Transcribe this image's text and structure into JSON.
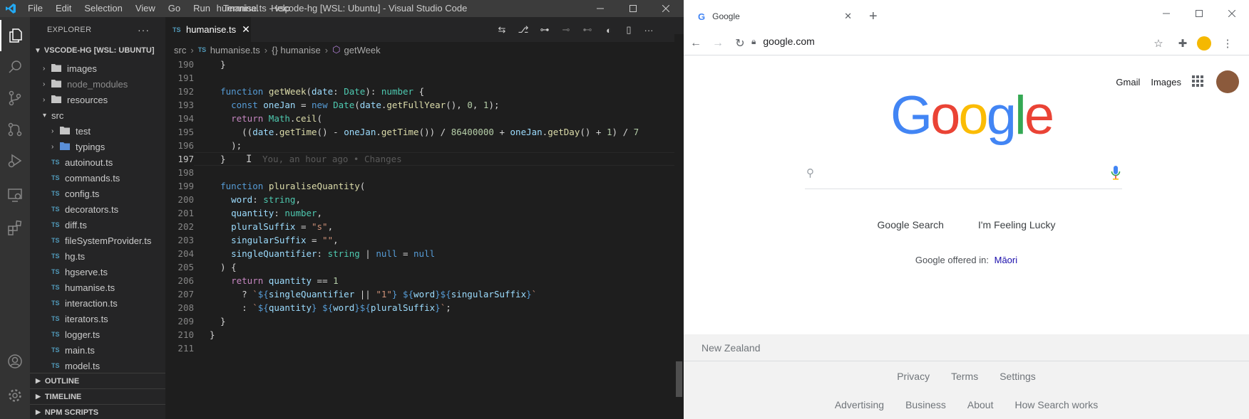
{
  "vscode": {
    "menu": [
      "File",
      "Edit",
      "Selection",
      "View",
      "Go",
      "Run",
      "Terminal",
      "Help"
    ],
    "window_title": "humanise.ts - vscode-hg [WSL: Ubuntu] - Visual Studio Code",
    "explorer_title": "EXPLORER",
    "workspace_title": "VSCODE-HG [WSL: UBUNTU]",
    "tree": [
      {
        "label": "images",
        "kind": "folder"
      },
      {
        "label": "node_modules",
        "kind": "folder"
      },
      {
        "label": "resources",
        "kind": "folder"
      },
      {
        "label": "src",
        "kind": "folder-open"
      },
      {
        "label": "test",
        "kind": "folder"
      },
      {
        "label": "typings",
        "kind": "folder"
      },
      {
        "label": "autoinout.ts",
        "kind": "ts"
      },
      {
        "label": "commands.ts",
        "kind": "ts"
      },
      {
        "label": "config.ts",
        "kind": "ts"
      },
      {
        "label": "decorators.ts",
        "kind": "ts"
      },
      {
        "label": "diff.ts",
        "kind": "ts"
      },
      {
        "label": "fileSystemProvider.ts",
        "kind": "ts"
      },
      {
        "label": "hg.ts",
        "kind": "ts"
      },
      {
        "label": "hgserve.ts",
        "kind": "ts"
      },
      {
        "label": "humanise.ts",
        "kind": "ts"
      },
      {
        "label": "interaction.ts",
        "kind": "ts"
      },
      {
        "label": "iterators.ts",
        "kind": "ts"
      },
      {
        "label": "logger.ts",
        "kind": "ts"
      },
      {
        "label": "main.ts",
        "kind": "ts"
      },
      {
        "label": "model.ts",
        "kind": "ts"
      }
    ],
    "ts_badge": "TS",
    "sections": [
      "OUTLINE",
      "TIMELINE",
      "NPM SCRIPTS"
    ],
    "tab_label": "humanise.ts",
    "breadcrumb": [
      "src",
      "humanise.ts",
      "{} humanise",
      "getWeek"
    ],
    "line_numbers": [
      "190",
      "191",
      "192",
      "193",
      "194",
      "195",
      "196",
      "197",
      "198",
      "199",
      "200",
      "201",
      "202",
      "203",
      "204",
      "205",
      "206",
      "207",
      "208",
      "209",
      "210",
      "211"
    ],
    "blame": "You, an hour ago • Changes"
  },
  "chrome": {
    "tab_title": "Google",
    "url": "google.com",
    "header_links": [
      "Gmail",
      "Images"
    ],
    "search_placeholder": "",
    "buttons": [
      "Google Search",
      "I'm Feeling Lucky"
    ],
    "offered_in": "Google offered in:",
    "language": "Māori",
    "country": "New Zealand",
    "footer_row1": [
      "Privacy",
      "Terms",
      "Settings"
    ],
    "footer_row2": [
      "Advertising",
      "Business",
      "About",
      "How Search works"
    ]
  },
  "colors": {
    "vscode_bg": "#1e1e1e",
    "accent_blue": "#007acc",
    "google_blue": "#4285f4",
    "google_red": "#ea4335",
    "google_yellow": "#fbbc05",
    "google_green": "#34a853"
  }
}
